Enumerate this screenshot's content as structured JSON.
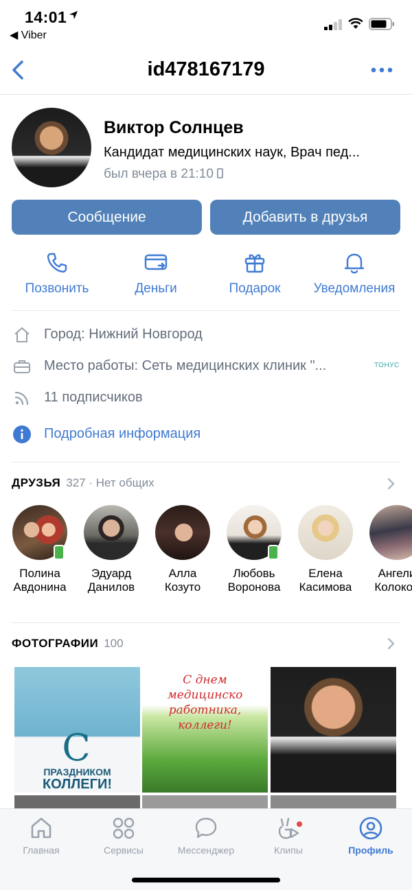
{
  "status_bar": {
    "time": "14:01",
    "back_app": "◀ Viber"
  },
  "nav": {
    "title": "id478167179"
  },
  "profile": {
    "name": "Виктор Солнцев",
    "subtitle": "Кандидат медицинских наук, Врач пед...",
    "last_seen": "был вчера в 21:10"
  },
  "buttons": {
    "message": "Сообщение",
    "add_friend": "Добавить в друзья"
  },
  "actions": [
    {
      "label": "Позвонить",
      "icon": "phone-icon"
    },
    {
      "label": "Деньги",
      "icon": "money-card-icon"
    },
    {
      "label": "Подарок",
      "icon": "gift-icon"
    },
    {
      "label": "Уведомления",
      "icon": "bell-icon"
    }
  ],
  "info": {
    "city": "Город: Нижний Новгород",
    "work": "Место работы: Сеть медицинских клиник \"...",
    "work_logo": "ТОНУС",
    "followers": "11 подписчиков",
    "details": "Подробная информация"
  },
  "friends": {
    "title": "ДРУЗЬЯ",
    "count": "327 · Нет общих",
    "items": [
      {
        "first": "Полина",
        "last": "Авдонина",
        "mobile": true,
        "color": "#7a4a3a"
      },
      {
        "first": "Эдуард",
        "last": "Данилов",
        "mobile": false,
        "color": "#4a4a48"
      },
      {
        "first": "Алла",
        "last": "Козуто",
        "mobile": false,
        "color": "#3a2a28"
      },
      {
        "first": "Любовь",
        "last": "Воронова",
        "mobile": true,
        "color": "#c9b08a"
      },
      {
        "first": "Елена",
        "last": "Касимова",
        "mobile": false,
        "color": "#e2cfa6"
      },
      {
        "first": "Ангели",
        "last": "Колокол",
        "mobile": false,
        "color": "#6b5a52"
      }
    ]
  },
  "photos": {
    "title": "ФОТОГРАФИИ",
    "count": "100",
    "p1_text1": "С",
    "p1_text2": "ПРАЗДНИКОМ",
    "p1_text3": "КОЛЛЕГИ!",
    "p2_text": "С днем медицинско работника, коллеги!"
  },
  "tabbar": [
    {
      "label": "Главная",
      "icon": "home-icon"
    },
    {
      "label": "Сервисы",
      "icon": "services-icon"
    },
    {
      "label": "Мессенджер",
      "icon": "messenger-icon"
    },
    {
      "label": "Клипы",
      "icon": "clips-icon"
    },
    {
      "label": "Профиль",
      "icon": "profile-icon"
    }
  ],
  "colors": {
    "accent": "#5181b8",
    "link": "#3f7ad2",
    "secondary_text": "#818c99"
  }
}
